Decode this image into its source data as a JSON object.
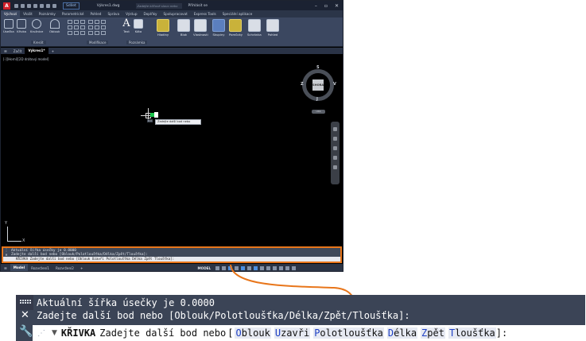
{
  "app": {
    "logo_letter": "A",
    "share_label": "Sdílet",
    "document": "Výkres1.dwg",
    "search_placeholder": "Zadejte klíčové slovo nebo výraz",
    "user": "Přihlásit se"
  },
  "ribbon": {
    "tabs": [
      "Výchozí",
      "Vložit",
      "Poznámky",
      "Parametrické",
      "Pohled",
      "Správa",
      "Výstup",
      "Doplňky",
      "Spolupracovat",
      "Express Tools",
      "Speciální aplikace"
    ],
    "tools": {
      "line": "Úsečka",
      "polyline": "Křivka",
      "circle": "Kružnice",
      "arc": "Oblouk",
      "text": "Text",
      "dim": "Kóta",
      "layers": "Hladiny",
      "block": "Blok",
      "props": "Vlastnosti",
      "groups": "Skupiny",
      "utilities": "Pomůcky",
      "clipboard": "Schránka",
      "view": "Pohled"
    },
    "panels": {
      "draw": "Kreslit",
      "modify": "Modifikace",
      "annotation": "Poznámka"
    }
  },
  "file_tabs": {
    "start": "Začít",
    "drawing": "Výkres1*"
  },
  "viewport": {
    "label": "[-][Horní][2D drátový model]",
    "cube_face": "SHORA",
    "dir_n": "S",
    "dir_w": "Z",
    "dir_e": "V",
    "dir_s": "J",
    "wcs": "USS",
    "cursor_tip_small": "D.C",
    "cursor_tip": "Zadejte další bod nebo",
    "ucs_x": "X",
    "ucs_y": "Y"
  },
  "status": {
    "model_tab": "Model",
    "layout1": "Rozvržení1",
    "layout2": "Rozvržení2",
    "mode": "MODEL"
  },
  "command_line": {
    "history_1": "Aktuální šířka úsečky je 0.0000",
    "history_2": "Zadejte další bod nebo [Oblouk/Polotloušťka/Délka/Zpět/Tloušťka]:",
    "command": "KŘIVKA",
    "prompt": "Zadejte další bod nebo",
    "options": [
      {
        "key": "O",
        "rest": "blouk"
      },
      {
        "key": "U",
        "rest": "zavři"
      },
      {
        "key": "P",
        "rest": "olotloušťka"
      },
      {
        "key": "D",
        "rest": "élka"
      },
      {
        "key": "Z",
        "rest": "pět"
      },
      {
        "key": "T",
        "rest": "loušťka"
      }
    ],
    "small_input": "KŘIVKA Zadejte další bod nebo [Oblouk Uzavři Polotloušťka Délka Zpět Tloušťka]:"
  },
  "colors": {
    "accent_orange": "#e8761b",
    "option_key_blue": "#1d3fc4",
    "command_bg": "#3b4456"
  }
}
